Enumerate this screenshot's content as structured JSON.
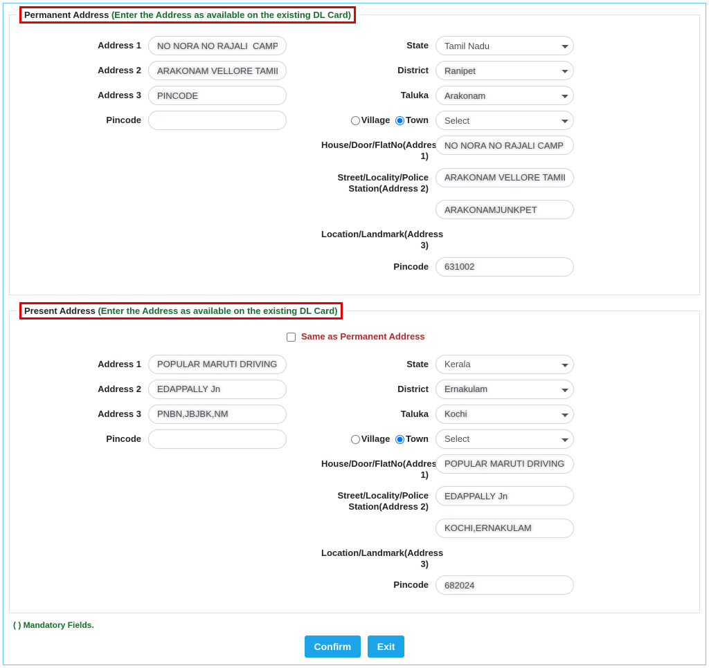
{
  "permanent": {
    "legend_prefix": "Permanent Address ",
    "legend_note": "(Enter the Address as available on the existing DL Card)",
    "left": {
      "address1_label": "Address 1",
      "address1_value": "NO NORA NO RAJALI  CAMP POST",
      "address2_label": "Address 2",
      "address2_value": "ARAKONAM VELLORE TAMILNADU",
      "address3_label": "Address 3",
      "address3_value": "PINCODE",
      "pincode_label": "Pincode",
      "pincode_value": ""
    },
    "right": {
      "state_label": "State",
      "state_value": "Tamil Nadu",
      "district_label": "District",
      "district_value": "Ranipet",
      "taluka_label": "Taluka",
      "taluka_value": "Arakonam",
      "village_label": "Village",
      "town_label": "Town",
      "vt_select_value": "Select",
      "house_label": "House/Door/FlatNo(Address 1)",
      "house_value": "NO NORA NO RAJALI CAMP POST",
      "street_label": "Street/Locality/Police Station(Address 2)",
      "street_value": "ARAKONAM VELLORE TAMILNADU",
      "location_label": "Location/Landmark(Address 3)",
      "location_value": "ARAKONAMJUNKPET",
      "pincode_label": "Pincode",
      "pincode_value": "631002"
    }
  },
  "present": {
    "legend_prefix": "Present Address ",
    "legend_note": "(Enter the Address as available on the existing DL Card)",
    "same_label": "Same as Permanent Address",
    "left": {
      "address1_label": "Address 1",
      "address1_value": "POPULAR MARUTI DRIVING SCHOO",
      "address2_label": "Address 2",
      "address2_value": "EDAPPALLY Jn",
      "address3_label": "Address 3",
      "address3_value": "PNBN,JBJBK,NM",
      "pincode_label": "Pincode",
      "pincode_value": ""
    },
    "right": {
      "state_label": "State",
      "state_value": "Kerala",
      "district_label": "District",
      "district_value": "Ernakulam",
      "taluka_label": "Taluka",
      "taluka_value": "Kochi",
      "village_label": "Village",
      "town_label": "Town",
      "vt_select_value": "Select",
      "house_label": "House/Door/FlatNo(Address 1)",
      "house_value": "POPULAR MARUTI DRIVING SCHOO",
      "street_label": "Street/Locality/Police Station(Address 2)",
      "street_value": "EDAPPALLY Jn",
      "location_label": "Location/Landmark(Address 3)",
      "location_value": "KOCHI,ERNAKULAM",
      "pincode_label": "Pincode",
      "pincode_value": "682024"
    }
  },
  "footer": {
    "mandatory": "(  ) Mandatory Fields.",
    "confirm": "Confirm",
    "exit": "Exit"
  }
}
